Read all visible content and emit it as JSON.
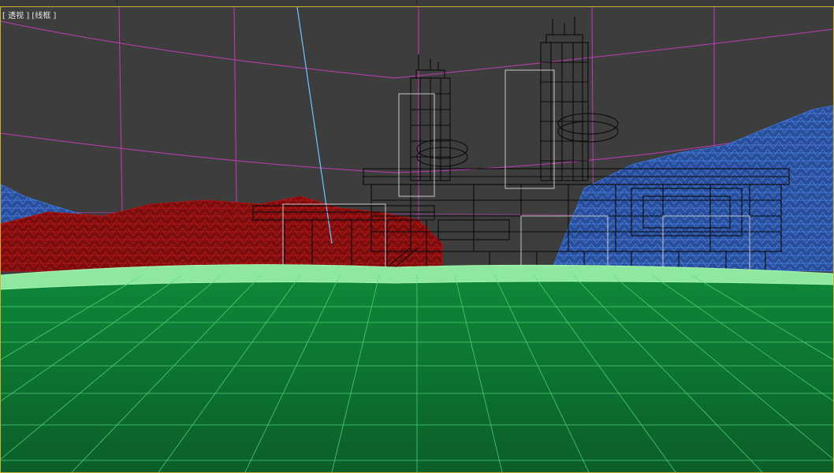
{
  "viewport": {
    "label": "[ 透视 ] [线框 ]",
    "border_color": "#c8b432",
    "background": "#3d3d3d"
  },
  "colors": {
    "sky_grid": "#c23bb8",
    "ground_fill": "#0f8a3a",
    "ground_grid": "#54e07a",
    "ground_edge": "#a8f5b0",
    "mountains_blue": "#3a6fd0",
    "mountains_red": "#b01010",
    "structure": "#0a0a0a",
    "camera_line": "#6fc8ff",
    "helper_box": "#d8d8d8"
  },
  "icons": {
    "scene": "wireframe-scene"
  }
}
